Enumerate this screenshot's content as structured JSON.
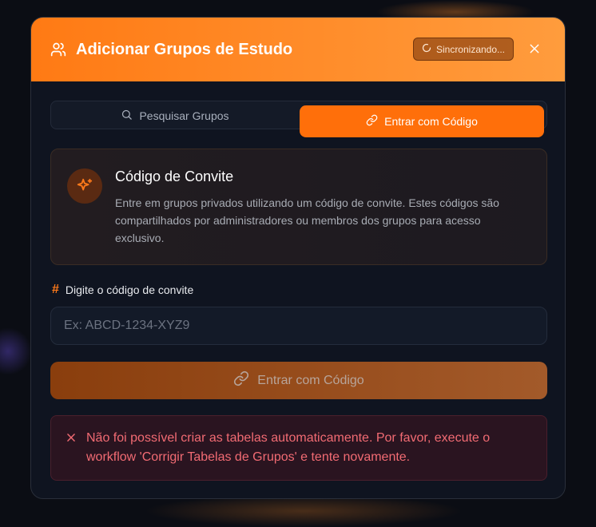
{
  "modal": {
    "title": "Adicionar Grupos de Estudo",
    "sync_label": "Sincronizando...",
    "close_label": "×"
  },
  "tabs": [
    {
      "label": "Pesquisar Grupos",
      "icon": "search-icon",
      "active": false
    },
    {
      "label": "Entrar com Código",
      "icon": "link-icon",
      "active": true
    }
  ],
  "info": {
    "title": "Código de Convite",
    "text": "Entre em grupos privados utilizando um código de convite. Estes códigos são compartilhados por administradores ou membros dos grupos para acesso exclusivo.",
    "icon": "sparkle-icon"
  },
  "field": {
    "label": "Digite o código de convite",
    "icon": "hash-icon",
    "placeholder": "Ex: ABCD-1234-XYZ9",
    "value": ""
  },
  "submit": {
    "label": "Entrar com Código",
    "icon": "link-icon"
  },
  "error": {
    "text": "Não foi possível criar as tabelas automaticamente. Por favor, execute o workflow 'Corrigir Tabelas de Grupos' e tente novamente.",
    "icon": "x-icon"
  },
  "colors": {
    "accent": "#ff6f0a",
    "header_gradient_start": "#ff7a14",
    "header_gradient_end": "#ff9c3d",
    "error": "#f26b73",
    "background": "#0f1420"
  }
}
